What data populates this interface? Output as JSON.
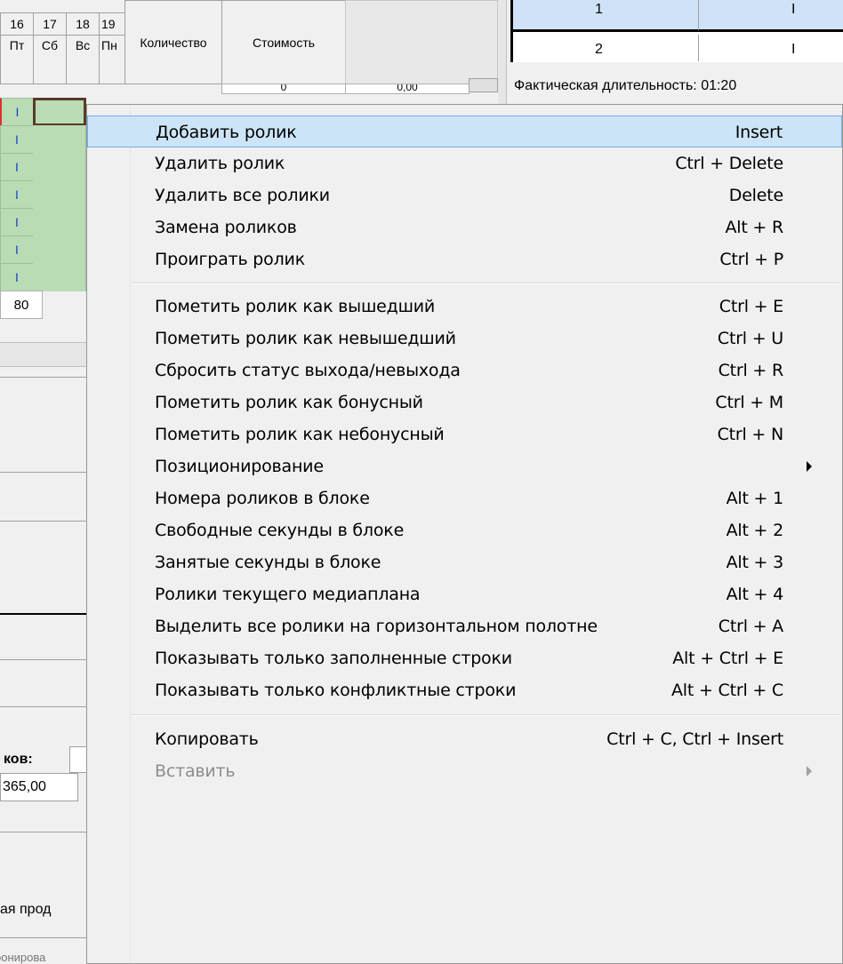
{
  "grid": {
    "days": [
      {
        "num": "16",
        "dow": "Пт"
      },
      {
        "num": "17",
        "dow": "Сб"
      },
      {
        "num": "18",
        "dow": "Вс"
      },
      {
        "num": "19",
        "dow": "Пн"
      }
    ],
    "col_quantity": "Количество",
    "col_cost": "Стоимость",
    "quantity_value": "0",
    "cost_value": "0,00",
    "cell_mark": "I",
    "total_value": "80"
  },
  "right_panel": {
    "row1": "1",
    "row1_mark": "I",
    "row2": "2",
    "row2_mark": "I",
    "actual_duration": "Фактическая длительность: 01:20"
  },
  "left_panel": {
    "count_label": "ков:",
    "amount_value": "365,00",
    "fragment_text": "ая прод",
    "bottom_fragment": "ронирова"
  },
  "menu": {
    "items": [
      {
        "label": "Добавить ролик",
        "shortcut": "Insert"
      },
      {
        "label": "Удалить ролик",
        "shortcut": "Ctrl + Delete"
      },
      {
        "label": "Удалить все ролики",
        "shortcut": "Delete"
      },
      {
        "label": "Замена роликов",
        "shortcut": "Alt + R"
      },
      {
        "label": "Проиграть ролик",
        "shortcut": "Ctrl + P"
      },
      {
        "label": "Пометить ролик как вышедший",
        "shortcut": "Ctrl + E"
      },
      {
        "label": "Пометить ролик как невышедший",
        "shortcut": "Ctrl + U"
      },
      {
        "label": "Сбросить статус выхода/невыхода",
        "shortcut": "Ctrl + R"
      },
      {
        "label": "Пометить ролик как бонусный",
        "shortcut": "Ctrl + M"
      },
      {
        "label": "Пометить ролик как небонусный",
        "shortcut": "Ctrl + N"
      },
      {
        "label": "Позиционирование",
        "shortcut": ""
      },
      {
        "label": "Номера роликов в блоке",
        "shortcut": "Alt + 1"
      },
      {
        "label": "Свободные секунды в блоке",
        "shortcut": "Alt + 2"
      },
      {
        "label": "Занятые секунды в блоке",
        "shortcut": "Alt + 3"
      },
      {
        "label": "Ролики текущего медиаплана",
        "shortcut": "Alt + 4"
      },
      {
        "label": "Выделить все ролики на горизонтальном полотне",
        "shortcut": "Ctrl + A"
      },
      {
        "label": "Показывать только заполненные строки",
        "shortcut": "Alt + Ctrl + E"
      },
      {
        "label": "Показывать только конфликтные строки",
        "shortcut": "Alt + Ctrl + C"
      },
      {
        "label": "Копировать",
        "shortcut": "Ctrl + C, Ctrl + Insert"
      },
      {
        "label": "Вставить",
        "shortcut": ""
      }
    ]
  },
  "colors": {
    "highlight": "#cce4f7",
    "highlight_border": "#75aee6",
    "cell_green": "#b9dcb4",
    "cell_mark": "#1a3cc8",
    "selected_cell_red": "#e03030"
  }
}
